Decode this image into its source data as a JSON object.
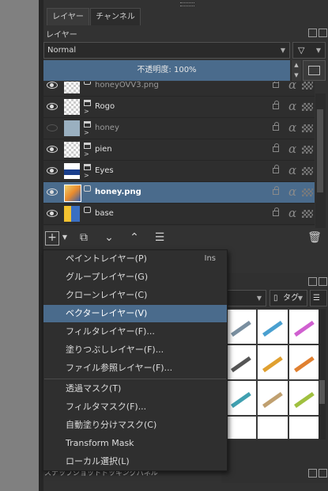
{
  "tabs": [
    {
      "label": "レイヤー"
    },
    {
      "label": "チャンネル"
    }
  ],
  "layers_panel": {
    "title": "レイヤー",
    "blend_mode": "Normal",
    "opacity_label": "不透明度: 100%"
  },
  "layers": [
    {
      "name": "honeyOVV3.png",
      "visible": true,
      "type": "vector",
      "dim": true
    },
    {
      "name": "Rogo",
      "visible": true,
      "type": "group"
    },
    {
      "name": "honey",
      "visible": false,
      "type": "group",
      "dim": true
    },
    {
      "name": "pien",
      "visible": true,
      "type": "group"
    },
    {
      "name": "Eyes",
      "visible": true,
      "type": "group"
    },
    {
      "name": "honey.png",
      "visible": true,
      "type": "vector",
      "selected": true
    },
    {
      "name": "base",
      "visible": true,
      "type": "vector"
    }
  ],
  "brush_panel": {
    "tag_label": "タグ"
  },
  "bottom_panel": {
    "title": "スナップショットドッキングパネル"
  },
  "add_layer_menu": [
    {
      "label": "ペイントレイヤー(P)",
      "shortcut": "Ins"
    },
    {
      "label": "グループレイヤー(G)",
      "shortcut": ""
    },
    {
      "label": "クローンレイヤー(C)",
      "shortcut": ""
    },
    {
      "label": "ベクターレイヤー(V)",
      "shortcut": "",
      "highlighted": true
    },
    {
      "label": "フィルタレイヤー(F)...",
      "shortcut": ""
    },
    {
      "label": "塗りつぶしレイヤー(F)...",
      "shortcut": ""
    },
    {
      "label": "ファイル参照レイヤー(F)...",
      "shortcut": ""
    },
    {
      "label": "透過マスク(T)",
      "shortcut": ""
    },
    {
      "label": "フィルタマスク(F)...",
      "shortcut": ""
    },
    {
      "label": "自動塗り分けマスク(C)",
      "shortcut": ""
    },
    {
      "label": "Transform Mask",
      "shortcut": ""
    },
    {
      "label": "ローカル選択(L)",
      "shortcut": ""
    }
  ],
  "colors": {
    "selection": "#4a6b8c",
    "panel_bg": "#323232",
    "canvas_gray": "#808080"
  }
}
